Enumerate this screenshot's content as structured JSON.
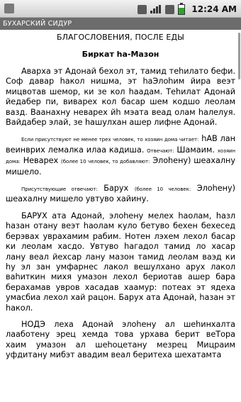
{
  "status_bar": {
    "time": "12:24 AM"
  },
  "title_bar": {
    "title": "БУХАРСКИЙ СИДУР"
  },
  "content": {
    "heading": "БЛАГОСЛОВЕНИЯ, ПОСЛЕ ЕДЫ",
    "subheading": "Биркат hа-Мазон",
    "para1": "Аварха эт Адонай бехол эт, тамид теhилато бефи. Соф давар hакол нишма, эт hаЭлоhим йира веэт мицвотав шемор, ки зе кол hаадам. Теhилат Адонай йедабер пи, виварех кол басар шем кодшо леолам вазд. Ваанахну неварех йh мэата веад олам hалелуя. Вайдабер элай, зе hашулхан ашер лифне Адонай.",
    "para2_small1": "Если присутствуют не менее трех человек, то хозяин дома читает:",
    "para2_main1": "hАВ лан веинврих лемалка илаа кадиша.",
    "para2_small2": "Отвечают:",
    "para2_main2": "Шамаим.",
    "para2_small3": "хозяин дома:",
    "para2_main3": "Неварех",
    "para2_small4": "(более 10 человек, то добавляют:",
    "para2_main4": "Элоhену) шеахалну мишело.",
    "para3_small1": "Присутствующие отвечают:",
    "para3_main1": "Барух",
    "para3_small2": "(более 10 человек:",
    "para3_main2": "Элоhену) шеахалну мишело увтуво хайину.",
    "para4": "БАРУХ ата Адонай, элоhену мелех hаолам, hазл hазан отану веэт hаолам куло бетуво бехен бехесед берэвах уврахамим рабим. Нотен лэхем лехол басар ки леолам хасдо. Увтуво hагадол тамид ло хасар лану веал йехсар лану мазон тамид леолам ваэд ки hу эл зан умфарнес лакол вешулхано арух лакол ваhиткин михя умазон лехол бериотав ашер бара берахамав увров хасадав хаамур: потеах эт ядеха умасбиа лехол хай рацон. Барух ата Адонай, hазан эт hакол.",
    "para5": "НОДЭ леха Адонай элоhену ал шеhинхалта лааботену эрец хемда това урхава берит веТора хаим умазон ал шеhоцетану мезрец Мицраим уфдитану мибэт авадим веал беритеха шехатамта"
  }
}
